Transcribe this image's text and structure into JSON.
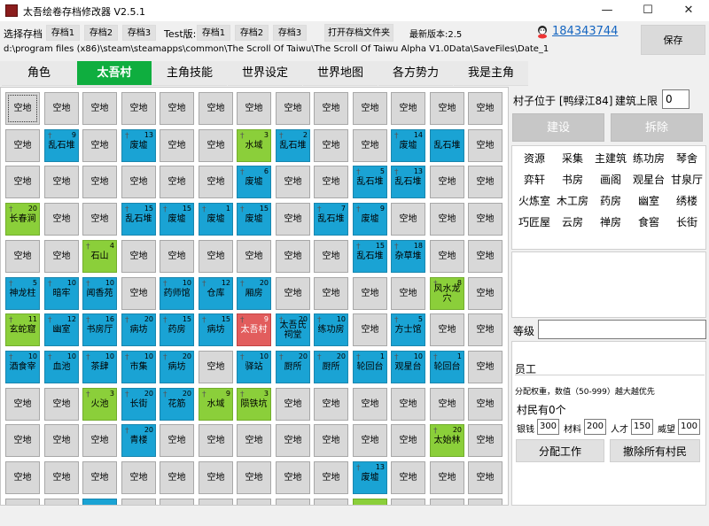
{
  "window": {
    "title": "太吾绘卷存档修改器 V2.5.1",
    "minimize": "—",
    "maximize": "☐",
    "close": "✕"
  },
  "toolbar": {
    "select_save_label": "选择存档",
    "saves": [
      "存档1",
      "存档2",
      "存档3"
    ],
    "test_label": "Test版:",
    "test_saves": [
      "存档1",
      "存档2",
      "存档3"
    ],
    "open_folder": "打开存档文件夹",
    "latest_version": "最新版本:2.5",
    "qq": "184343744",
    "save_button": "保存",
    "path": "d:\\program files (x86)\\steam\\steamapps\\common\\The Scroll Of Taiwu\\The Scroll Of Taiwu Alpha V1.0Data\\SaveFiles\\Date_1"
  },
  "tabs": [
    {
      "label": "角色",
      "active": false
    },
    {
      "label": "太吾村",
      "active": true
    },
    {
      "label": "主角技能",
      "active": false
    },
    {
      "label": "世界设定",
      "active": false
    },
    {
      "label": "世界地图",
      "active": false
    },
    {
      "label": "各方势力",
      "active": false
    },
    {
      "label": "我是主角",
      "active": false
    }
  ],
  "grid": {
    "rows": [
      [
        [
          "空地",
          "",
          ""
        ],
        [
          "空地",
          "",
          ""
        ],
        [
          "空地",
          "",
          ""
        ],
        [
          "空地",
          "",
          ""
        ],
        [
          "空地",
          "",
          ""
        ],
        [
          "空地",
          "",
          ""
        ],
        [
          "空地",
          "",
          ""
        ],
        [
          "空地",
          "",
          ""
        ],
        [
          "空地",
          "",
          ""
        ],
        [
          "空地",
          "",
          ""
        ],
        [
          "空地",
          "",
          ""
        ],
        [
          "空地",
          "",
          ""
        ],
        [
          "空地",
          "",
          ""
        ]
      ],
      [
        [
          "空地",
          "",
          ""
        ],
        [
          "乱石堆",
          "9",
          "blue"
        ],
        [
          "空地",
          "",
          ""
        ],
        [
          "废墟",
          "13",
          "blue"
        ],
        [
          "空地",
          "",
          ""
        ],
        [
          "空地",
          "",
          ""
        ],
        [
          "水域",
          "3",
          "green"
        ],
        [
          "乱石堆",
          "2",
          "blue"
        ],
        [
          "空地",
          "",
          ""
        ],
        [
          "空地",
          "",
          ""
        ],
        [
          "废墟",
          "14",
          "blue"
        ],
        [
          "乱石堆",
          "",
          "blue"
        ],
        [
          "空地",
          "",
          ""
        ]
      ],
      [
        [
          "空地",
          "",
          ""
        ],
        [
          "空地",
          "",
          ""
        ],
        [
          "空地",
          "",
          ""
        ],
        [
          "空地",
          "",
          ""
        ],
        [
          "空地",
          "",
          ""
        ],
        [
          "空地",
          "",
          ""
        ],
        [
          "废墟",
          "6",
          "blue"
        ],
        [
          "空地",
          "",
          ""
        ],
        [
          "空地",
          "",
          ""
        ],
        [
          "乱石堆",
          "5",
          "blue"
        ],
        [
          "乱石堆",
          "13",
          "blue"
        ],
        [
          "空地",
          "",
          ""
        ],
        [
          "空地",
          "",
          ""
        ]
      ],
      [
        [
          "长春涧",
          "20",
          "green"
        ],
        [
          "空地",
          "",
          ""
        ],
        [
          "空地",
          "",
          ""
        ],
        [
          "乱石堆",
          "15",
          "blue"
        ],
        [
          "废墟",
          "15",
          "blue"
        ],
        [
          "废墟",
          "1",
          "blue"
        ],
        [
          "废墟",
          "15",
          "blue"
        ],
        [
          "空地",
          "",
          ""
        ],
        [
          "乱石堆",
          "7",
          "blue"
        ],
        [
          "废墟",
          "9",
          "blue"
        ],
        [
          "空地",
          "",
          ""
        ],
        [
          "空地",
          "",
          ""
        ],
        [
          "空地",
          "",
          ""
        ]
      ],
      [
        [
          "空地",
          "",
          ""
        ],
        [
          "空地",
          "",
          ""
        ],
        [
          "石山",
          "4",
          "green"
        ],
        [
          "空地",
          "",
          ""
        ],
        [
          "空地",
          "",
          ""
        ],
        [
          "空地",
          "",
          ""
        ],
        [
          "空地",
          "",
          ""
        ],
        [
          "空地",
          "",
          ""
        ],
        [
          "空地",
          "",
          ""
        ],
        [
          "乱石堆",
          "15",
          "blue"
        ],
        [
          "杂草堆",
          "18",
          "blue"
        ],
        [
          "空地",
          "",
          ""
        ],
        [
          "空地",
          "",
          ""
        ]
      ],
      [
        [
          "神龙柱",
          "5",
          "blue"
        ],
        [
          "暗牢",
          "10",
          "blue"
        ],
        [
          "闻香苑",
          "10",
          "blue"
        ],
        [
          "空地",
          "",
          ""
        ],
        [
          "药师馆",
          "10",
          "blue"
        ],
        [
          "仓库",
          "12",
          "blue"
        ],
        [
          "厢房",
          "20",
          "blue"
        ],
        [
          "空地",
          "",
          ""
        ],
        [
          "空地",
          "",
          ""
        ],
        [
          "空地",
          "",
          ""
        ],
        [
          "空地",
          "",
          ""
        ],
        [
          "风水龙穴",
          "8",
          "green"
        ],
        [
          "空地",
          "",
          ""
        ]
      ],
      [
        [
          "玄蛇窟",
          "11",
          "green"
        ],
        [
          "幽室",
          "12",
          "blue"
        ],
        [
          "书房厅",
          "16",
          "blue"
        ],
        [
          "病坊",
          "20",
          "blue"
        ],
        [
          "药房",
          "15",
          "blue"
        ],
        [
          "病坊",
          "15",
          "blue"
        ],
        [
          "太吾村",
          "9",
          "red"
        ],
        [
          "太吾氏祠堂",
          "20",
          "blue"
        ],
        [
          "练功房",
          "10",
          "blue"
        ],
        [
          "空地",
          "",
          ""
        ],
        [
          "方士馆",
          "5",
          "blue"
        ],
        [
          "空地",
          "",
          ""
        ],
        [
          "空地",
          "",
          ""
        ]
      ],
      [
        [
          "酒食宰",
          "10",
          "blue"
        ],
        [
          "血池",
          "10",
          "blue"
        ],
        [
          "茶肆",
          "10",
          "blue"
        ],
        [
          "市集",
          "10",
          "blue"
        ],
        [
          "病坊",
          "20",
          "blue"
        ],
        [
          "空地",
          "",
          ""
        ],
        [
          "驿站",
          "10",
          "blue"
        ],
        [
          "厨所",
          "20",
          "blue"
        ],
        [
          "厨所",
          "20",
          "blue"
        ],
        [
          "轮回台",
          "1",
          "blue"
        ],
        [
          "观星台",
          "10",
          "blue"
        ],
        [
          "轮回台",
          "1",
          "blue"
        ],
        [
          "空地",
          "",
          ""
        ]
      ],
      [
        [
          "空地",
          "",
          ""
        ],
        [
          "空地",
          "",
          ""
        ],
        [
          "火池",
          "3",
          "green"
        ],
        [
          "长街",
          "20",
          "blue"
        ],
        [
          "花筋",
          "20",
          "blue"
        ],
        [
          "水域",
          "9",
          "green"
        ],
        [
          "陨铁坑",
          "3",
          "green"
        ],
        [
          "空地",
          "",
          ""
        ],
        [
          "空地",
          "",
          ""
        ],
        [
          "空地",
          "",
          ""
        ],
        [
          "空地",
          "",
          ""
        ],
        [
          "空地",
          "",
          ""
        ],
        [
          "空地",
          "",
          ""
        ]
      ],
      [
        [
          "空地",
          "",
          ""
        ],
        [
          "空地",
          "",
          ""
        ],
        [
          "空地",
          "",
          ""
        ],
        [
          "青楼",
          "20",
          "blue"
        ],
        [
          "空地",
          "",
          ""
        ],
        [
          "空地",
          "",
          ""
        ],
        [
          "空地",
          "",
          ""
        ],
        [
          "空地",
          "",
          ""
        ],
        [
          "空地",
          "",
          ""
        ],
        [
          "空地",
          "",
          ""
        ],
        [
          "空地",
          "",
          ""
        ],
        [
          "太始林",
          "20",
          "green"
        ],
        [
          "空地",
          "",
          ""
        ]
      ],
      [
        [
          "空地",
          "",
          ""
        ],
        [
          "空地",
          "",
          ""
        ],
        [
          "空地",
          "",
          ""
        ],
        [
          "空地",
          "",
          ""
        ],
        [
          "空地",
          "",
          ""
        ],
        [
          "空地",
          "",
          ""
        ],
        [
          "空地",
          "",
          ""
        ],
        [
          "空地",
          "",
          ""
        ],
        [
          "空地",
          "",
          ""
        ],
        [
          "废墟",
          "13",
          "blue"
        ],
        [
          "空地",
          "",
          ""
        ],
        [
          "空地",
          "",
          ""
        ],
        [
          "空地",
          "",
          ""
        ]
      ],
      [
        [
          "",
          "",
          ""
        ],
        [
          "",
          "",
          ""
        ],
        [
          "",
          "",
          "blue"
        ],
        [
          "",
          "",
          ""
        ],
        [
          "",
          "",
          ""
        ],
        [
          "",
          "",
          ""
        ],
        [
          "",
          "",
          ""
        ],
        [
          "",
          "",
          ""
        ],
        [
          "",
          "",
          ""
        ],
        [
          "",
          "",
          "green"
        ],
        [
          "",
          "",
          ""
        ],
        [
          "",
          "",
          ""
        ],
        [
          "",
          "",
          ""
        ]
      ]
    ]
  },
  "right": {
    "location": "村子位于 [鸭绿江84]",
    "build_limit_label": "建筑上限",
    "build_limit": "0",
    "build_btn": "建设",
    "demolish_btn": "拆除",
    "buildings": [
      "资源",
      "采集",
      "主建筑",
      "练功房",
      "琴舍",
      "弈轩",
      "书房",
      "画阁",
      "观星台",
      "甘泉厅",
      "火炼室",
      "木工房",
      "药房",
      "幽室",
      "绣楼",
      "巧匠屋",
      "云房",
      "禅房",
      "食窖",
      "长街"
    ],
    "level_label": "等级",
    "staff_label": "员工",
    "weight_note": "分配权重，数值（50-999）越大越优先",
    "villagers": "村民有0个",
    "res": [
      {
        "label": "银钱",
        "value": "300"
      },
      {
        "label": "材料",
        "value": "200"
      },
      {
        "label": "人才",
        "value": "150"
      },
      {
        "label": "威望",
        "value": "100"
      }
    ],
    "assign_btn": "分配工作",
    "revoke_btn": "撤除所有村民"
  }
}
